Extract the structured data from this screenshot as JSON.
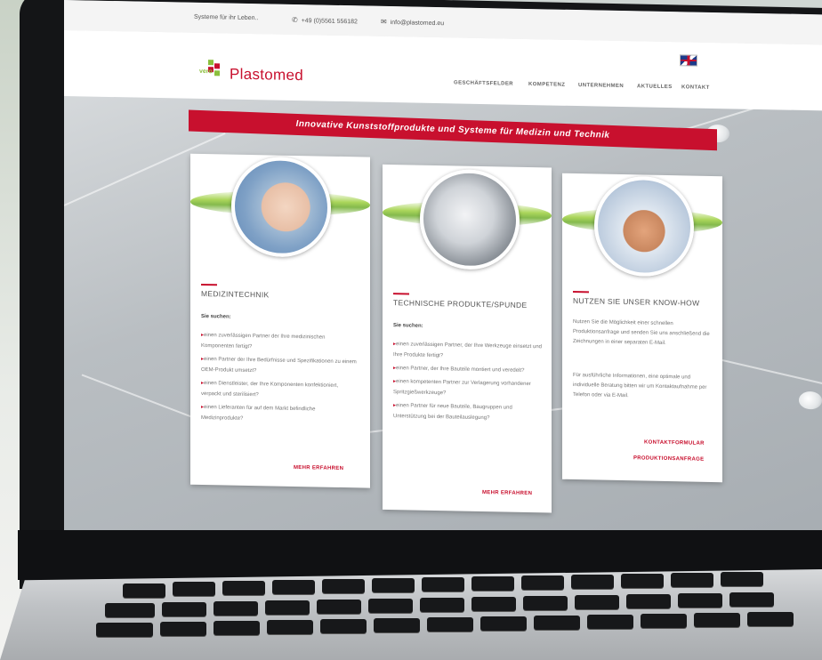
{
  "topbar": {
    "tagline": "Systeme für ihr Leben..",
    "phone": "+49 (0)5561 556182",
    "email": "info@plastomed.eu"
  },
  "logo": {
    "prefix": "vero",
    "name": "Plastomed"
  },
  "nav": {
    "items": [
      "GESCHÄFTSFELDER",
      "KOMPETENZ",
      "UNTERNEHMEN",
      "AKTUELLES",
      "KONTAKT"
    ]
  },
  "banner": {
    "text": "Innovative Kunststoffprodukte und Systeme für Medizin und Technik"
  },
  "cards": [
    {
      "title": "MEDIZINTECHNIK",
      "subtitle": "Sie suchen:",
      "bullets": [
        "einen zuverlässigen Partner der Ihre medizinischen Komponenten fertigt?",
        "einen Partner der Ihre Bedürfnisse und Spezifikationen zu einem OEM-Produkt umsetzt?",
        "einen Dienstleister, der Ihre Komponenten konfektioniert, verpackt und sterilisiert?",
        "einen Lieferanten für auf dem Markt befindliche Medizinprodukte?"
      ],
      "link": "MEHR ERFAHREN"
    },
    {
      "title": "TECHNISCHE PRODUKTE/SPUNDE",
      "subtitle": "Sie suchen:",
      "bullets": [
        "einen zuverlässigen Partner, der Ihre Werkzeuge einsetzt und Ihre Produkte fertigt?",
        "einen Partner, der Ihre Bauteile montiert und veredelt?",
        "einen kompetenten Partner zur Verlagerung vorhandener Spritzgießwerkzeuge?",
        "einen Partner für neue Bauteile, Baugruppen und Unterstützung bei der Bauteilauslegung?"
      ],
      "link": "MEHR ERFAHREN"
    },
    {
      "title": "NUTZEN SIE UNSER KNOW-HOW",
      "paragraphs": [
        "Nutzen Sie die Möglichkeit einer schnellen Produktionsanfrage und senden Sie uns anschließend die Zeichnungen in einer separaten E-Mail.",
        "Für ausführliche Informationen, eine optimale und individuelle Beratung bitten wir um Kontaktaufnahme per Telefon oder via E-Mail."
      ],
      "links": [
        "KONTAKTFORMULAR",
        "PRODUKTIONSANFRAGE"
      ]
    }
  ],
  "icons": {
    "phone": "phone-icon",
    "email": "envelope-icon",
    "language": "uk-flag-icon"
  },
  "colors": {
    "brand_red": "#c8102e",
    "brand_green": "#8bbf3d"
  }
}
